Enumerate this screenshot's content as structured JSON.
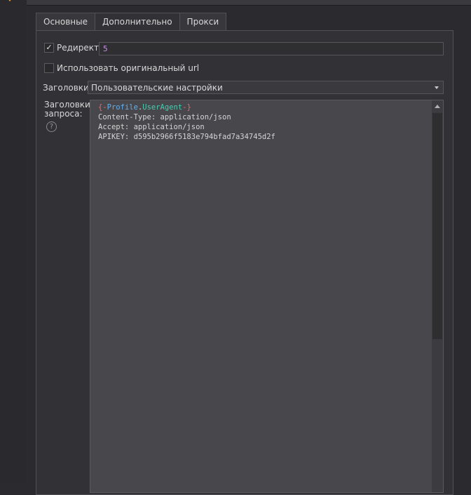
{
  "tabs": [
    {
      "label": "Основные"
    },
    {
      "label": "Дополнительно"
    },
    {
      "label": "Прокси"
    }
  ],
  "active_tab": "Дополнительно",
  "redirect": {
    "label": "Редирект",
    "checked": true,
    "value": "5"
  },
  "original_url": {
    "label": "Использовать оригинальный url",
    "checked": false
  },
  "headers": {
    "label": "Заголовки:",
    "selected": "Пользовательские настройки"
  },
  "request_headers": {
    "label_line1": "Заголовки",
    "label_line2": "запроса:",
    "help_symbol": "?",
    "line1": {
      "open": "{-",
      "obj": "Profile",
      "dot": ".",
      "prop": "UserAgent",
      "close": "-}"
    },
    "line2": "Content-Type: application/json",
    "line3": "Accept: application/json",
    "line4": "APIKEY: d595b2966f5183e794bfad7a34745d2f"
  },
  "colors": {
    "accent": "#f0a030",
    "macro_brace": "#e06c75",
    "macro_object": "#61afef",
    "macro_property": "#4ec9b0",
    "input_value": "#c792ea"
  }
}
